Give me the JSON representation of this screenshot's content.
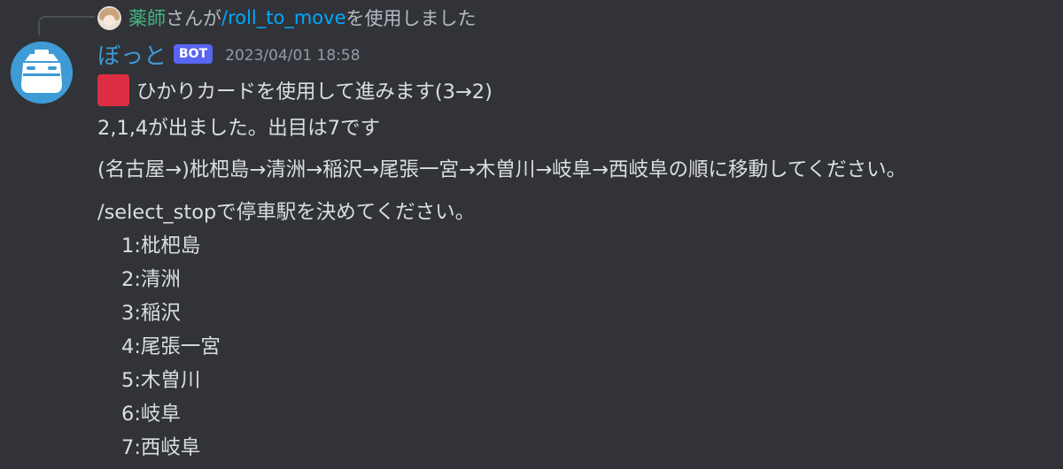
{
  "reply": {
    "user": "薬師",
    "text_before": "さんが",
    "command": "/roll_to_move",
    "text_after": "を使用しました"
  },
  "message": {
    "username": "ぼっと",
    "bot_tag": "BOT",
    "timestamp": "2023/04/01 18:58",
    "card_line": "ひかりカードを使用して進みます(3→2)",
    "dice_line": "2,1,4が出ました。出目は7です",
    "route_line": "(名古屋→)枇杷島→清洲→稲沢→尾張一宮→木曽川→岐阜→西岐阜の順に移動してください。",
    "instruction_line": "/select_stopで停車駅を決めてください。",
    "stops": [
      "1:枇杷島",
      "2:清洲",
      "3:稲沢",
      "4:尾張一宮",
      "5:木曽川",
      "6:岐阜",
      "7:西岐阜"
    ]
  },
  "colors": {
    "background": "#313338",
    "text": "#dbdee1",
    "bot_name": "#3e9bd6",
    "bot_tag": "#5865f2",
    "reply_user": "#43b581",
    "command_link": "#00a8fc",
    "red_square": "#dd2e44"
  },
  "icons": {
    "bot_avatar": "bot-avatar-icon",
    "reply_avatar": "user-avatar-icon",
    "card_marker": "red-square-icon"
  }
}
